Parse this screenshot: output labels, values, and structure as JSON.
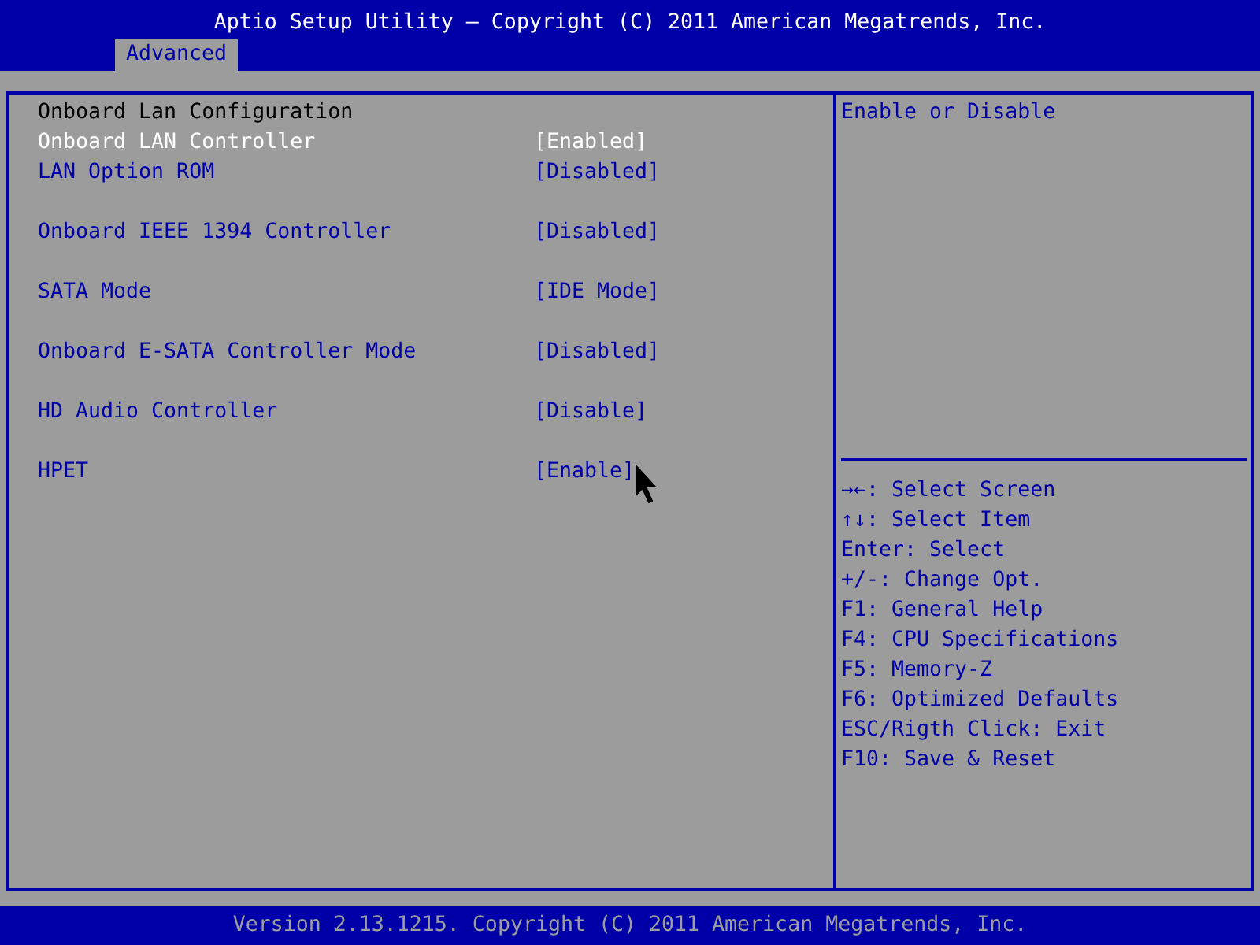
{
  "header": {
    "title": "Aptio Setup Utility – Copyright (C) 2011 American Megatrends, Inc."
  },
  "tabs": [
    {
      "label": "Advanced",
      "selected": true
    }
  ],
  "settings_groups": [
    {
      "items": [
        {
          "kind": "heading",
          "label": "Onboard Lan Configuration"
        },
        {
          "kind": "setting",
          "label": "Onboard LAN Controller",
          "value": "[Enabled]",
          "selected": true
        },
        {
          "kind": "setting",
          "label": "LAN Option ROM",
          "value": "[Disabled]",
          "selected": false
        }
      ]
    },
    {
      "items": [
        {
          "kind": "setting",
          "label": "Onboard IEEE 1394 Controller",
          "value": "[Disabled]",
          "selected": false
        }
      ]
    },
    {
      "items": [
        {
          "kind": "setting",
          "label": "SATA Mode",
          "value": "[IDE Mode]",
          "selected": false
        }
      ]
    },
    {
      "items": [
        {
          "kind": "setting",
          "label": "Onboard E-SATA Controller Mode",
          "value": "[Disabled]",
          "selected": false
        }
      ]
    },
    {
      "items": [
        {
          "kind": "setting",
          "label": "HD Audio Controller",
          "value": "[Disable]",
          "selected": false
        }
      ]
    },
    {
      "items": [
        {
          "kind": "setting",
          "label": "HPET",
          "value": "[Enable]",
          "selected": false
        }
      ]
    }
  ],
  "help_text": "Enable or Disable",
  "key_help": [
    "→←: Select Screen",
    "↑↓: Select Item",
    "Enter: Select",
    "+/-: Change Opt.",
    "F1: General Help",
    "F4: CPU Specifications",
    "F5: Memory-Z",
    "F6: Optimized Defaults",
    "ESC/Rigth Click: Exit",
    "F10: Save & Reset"
  ],
  "footer": {
    "text": "Version 2.13.1215. Copyright (C) 2011 American Megatrends, Inc."
  }
}
